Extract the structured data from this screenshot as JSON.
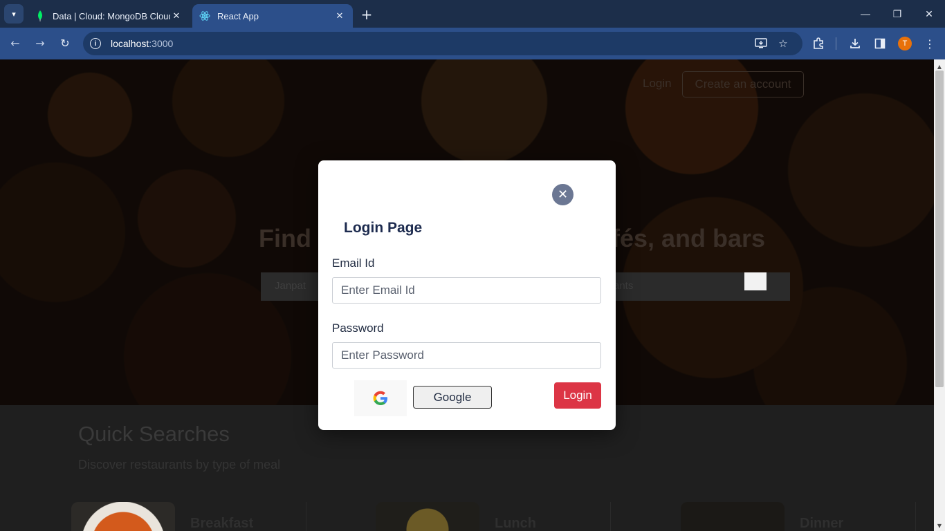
{
  "browser": {
    "tabs": [
      {
        "title": "Data | Cloud: MongoDB Cloud",
        "icon": "mongodb-leaf-icon",
        "active": false
      },
      {
        "title": "React App",
        "icon": "react-icon",
        "active": true
      }
    ],
    "url_host": "localhost",
    "url_port": ":3000",
    "profile_initial": "T",
    "accent_color": "#2c4f8a"
  },
  "page": {
    "header": {
      "login_label": "Login",
      "create_account_label": "Create an account"
    },
    "hero": {
      "heading_left": "Find",
      "heading_right": "fés, and bars",
      "location_placeholder_visible": "Janpat",
      "search_placeholder_visible": "ants"
    },
    "quick_searches": {
      "title": "Quick Searches",
      "subtitle": "Discover restaurants by type of meal",
      "meals": [
        "Breakfast",
        "Lunch",
        "Dinner"
      ]
    }
  },
  "modal": {
    "title": "Login Page",
    "email": {
      "label": "Email Id",
      "placeholder": "Enter Email Id",
      "value": ""
    },
    "password": {
      "label": "Password",
      "placeholder": "Enter Password",
      "value": ""
    },
    "google_button_label": "Google",
    "login_button_label": "Login",
    "login_button_color": "#dc3545",
    "close_button_color": "#6b7793"
  }
}
